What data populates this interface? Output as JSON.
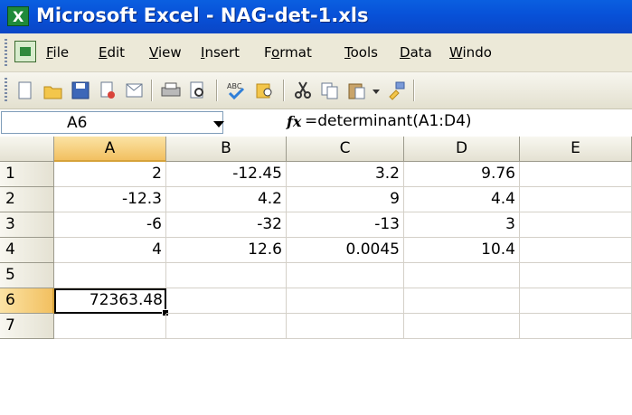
{
  "title": "Microsoft Excel - NAG-det-1.xls",
  "menu": [
    {
      "label": "File",
      "accel": 0
    },
    {
      "label": "Edit",
      "accel": 0
    },
    {
      "label": "View",
      "accel": 0
    },
    {
      "label": "Insert",
      "accel": 0
    },
    {
      "label": "Format",
      "accel": 1
    },
    {
      "label": "Tools",
      "accel": 0
    },
    {
      "label": "Data",
      "accel": 0
    },
    {
      "label": "Windo",
      "accel": 0
    }
  ],
  "toolbar_icons": [
    "new-icon",
    "open-icon",
    "save-icon",
    "permission-icon",
    "email-icon",
    "print-icon",
    "print-preview-icon",
    "spelling-icon",
    "research-icon",
    "cut-icon",
    "copy-icon",
    "paste-icon",
    "paste-dropdown-icon",
    "format-painter-icon"
  ],
  "name_box": "A6",
  "fx_label": "fx",
  "formula": "=determinant(A1:D4)",
  "columns": [
    "A",
    "B",
    "C",
    "D",
    "E"
  ],
  "active_column": "A",
  "active_row": "6",
  "rows": [
    {
      "num": "1",
      "cells": [
        "2",
        "-12.45",
        "3.2",
        "9.76",
        ""
      ]
    },
    {
      "num": "2",
      "cells": [
        "-12.3",
        "4.2",
        "9",
        "4.4",
        ""
      ]
    },
    {
      "num": "3",
      "cells": [
        "-6",
        "-32",
        "-13",
        "3",
        ""
      ]
    },
    {
      "num": "4",
      "cells": [
        "4",
        "12.6",
        "0.0045",
        "10.4",
        ""
      ]
    },
    {
      "num": "5",
      "cells": [
        "",
        "",
        "",
        "",
        ""
      ]
    },
    {
      "num": "6",
      "cells": [
        "72363.48",
        "",
        "",
        "",
        ""
      ]
    },
    {
      "num": "7",
      "cells": [
        "",
        "",
        "",
        "",
        ""
      ]
    }
  ],
  "colors": {
    "titlebar": "#0a5fe0",
    "active_header": "#f2c060",
    "chrome": "#ece9d8"
  }
}
